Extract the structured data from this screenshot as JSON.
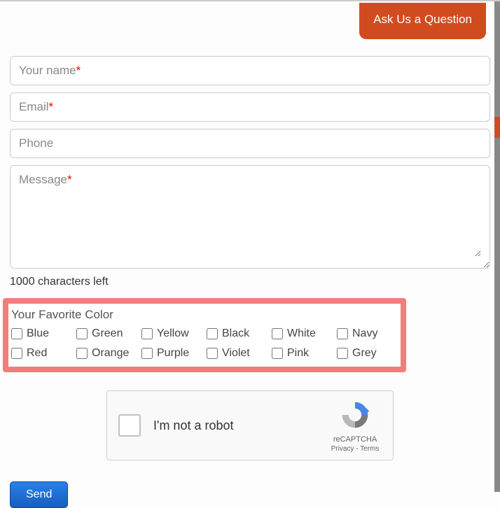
{
  "askButton": "Ask Us a Question",
  "fields": {
    "name": {
      "placeholder": "Your name",
      "required": true
    },
    "email": {
      "placeholder": "Email",
      "required": true
    },
    "phone": {
      "placeholder": "Phone",
      "required": false
    },
    "message": {
      "placeholder": "Message",
      "required": true
    }
  },
  "charCounter": "1000 characters left",
  "colorSection": {
    "label": "Your Favorite Color",
    "options": [
      "Blue",
      "Green",
      "Yellow",
      "Black",
      "White",
      "Navy",
      "Red",
      "Orange",
      "Purple",
      "Violet",
      "Pink",
      "Grey"
    ]
  },
  "recaptcha": {
    "label": "I'm not a robot",
    "brand": "reCAPTCHA",
    "links": "Privacy - Terms"
  },
  "sendButton": "Send",
  "requiredMark": "*"
}
